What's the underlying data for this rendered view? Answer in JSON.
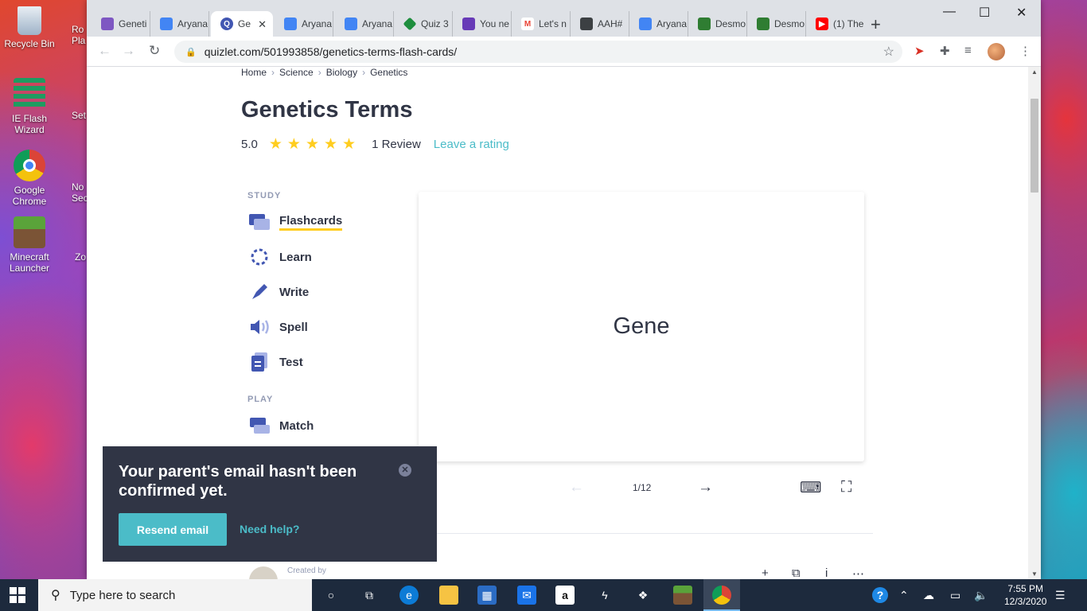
{
  "desktop": {
    "icons": [
      {
        "label": "Recycle Bin"
      },
      {
        "label": "IE Flash Wizard"
      },
      {
        "label": "Google Chrome"
      },
      {
        "label": "Minecraft Launcher"
      }
    ],
    "partial_labels": [
      "Ro Pla",
      "Set",
      "No Sec",
      "Zo"
    ]
  },
  "browser": {
    "tabs": [
      {
        "label": "Geneti",
        "icon": "purple-square"
      },
      {
        "label": "Aryana",
        "icon": "docs"
      },
      {
        "label": "Ge",
        "icon": "quizlet"
      },
      {
        "label": "Aryana",
        "icon": "docs"
      },
      {
        "label": "Aryana",
        "icon": "docs"
      },
      {
        "label": "Quiz 3",
        "icon": "green-diamond"
      },
      {
        "label": "You ne",
        "icon": "forms"
      },
      {
        "label": "Let's n",
        "icon": "gmail"
      },
      {
        "label": "AAH#",
        "icon": "contacts"
      },
      {
        "label": "Aryana",
        "icon": "docs"
      },
      {
        "label": "Desmo",
        "icon": "desmos"
      },
      {
        "label": "Desmo",
        "icon": "desmos"
      },
      {
        "label": "(1) The",
        "icon": "youtube"
      }
    ],
    "url": "quizlet.com/501993858/genetics-terms-flash-cards/"
  },
  "page": {
    "breadcrumb": [
      "Home",
      "Science",
      "Biology",
      "Genetics"
    ],
    "title": "Genetics Terms",
    "rating_value": "5.0",
    "stars": 5,
    "review_count": "1 Review",
    "leave_rating": "Leave a rating",
    "study_label": "STUDY",
    "play_label": "PLAY",
    "study_modes": [
      "Flashcards",
      "Learn",
      "Write",
      "Spell",
      "Test"
    ],
    "play_modes": [
      "Match"
    ],
    "card_term": "Gene",
    "card_counter": "1/12",
    "created_by": "Created by"
  },
  "toast": {
    "message": "Your parent's email hasn't been confirmed yet.",
    "resend": "Resend email",
    "help": "Need help?"
  },
  "taskbar": {
    "search_placeholder": "Type here to search",
    "time": "7:55 PM",
    "date": "12/3/2020"
  },
  "colors": {
    "quizlet_dark": "#303545",
    "quizlet_teal": "#4bbcc8",
    "star_yellow": "#ffcd1f",
    "mode_blue": "#4257b2"
  }
}
